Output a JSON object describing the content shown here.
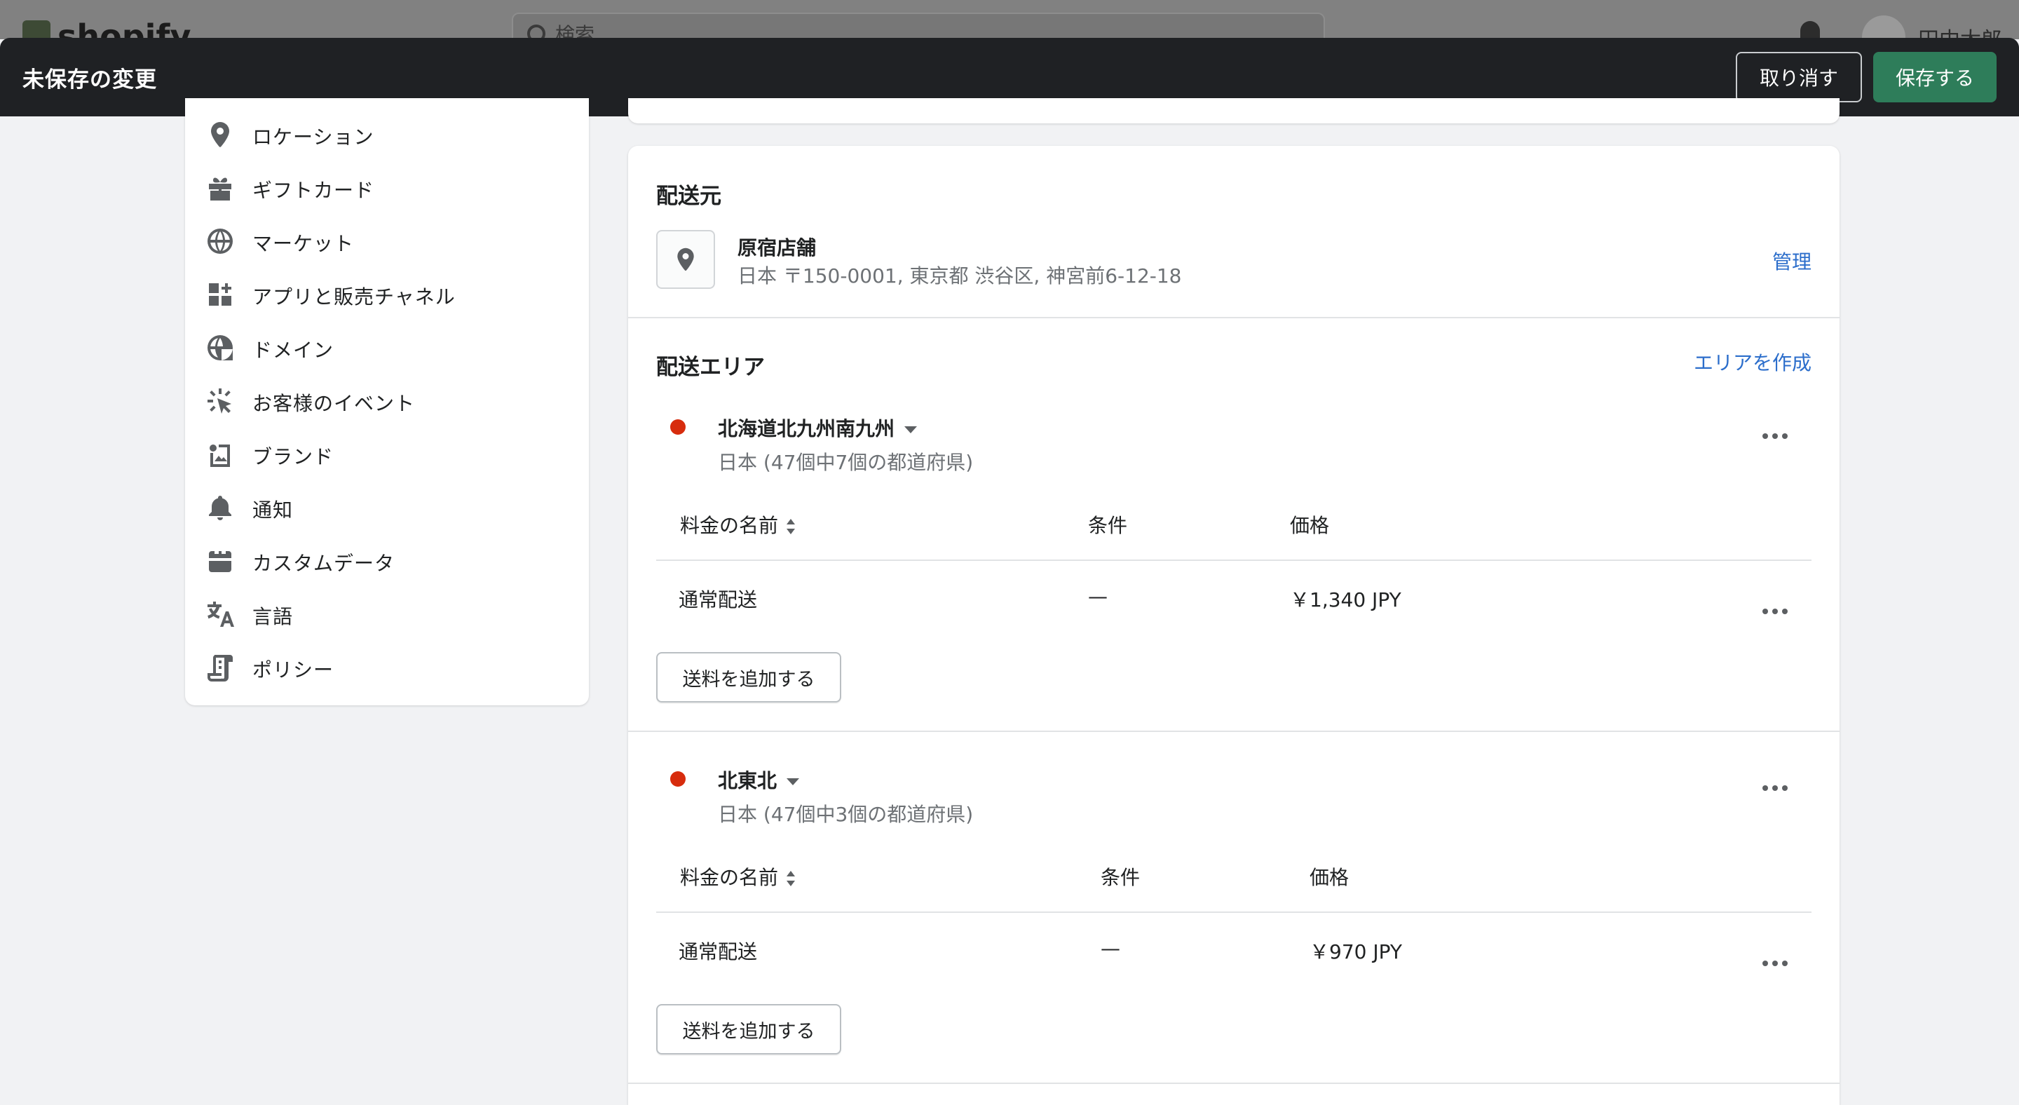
{
  "topbar": {
    "logo_text": "shopify",
    "search_placeholder": "検索",
    "user_name": "田中太郎"
  },
  "savebar": {
    "title": "未保存の変更",
    "discard_label": "取り消す",
    "save_label": "保存する",
    "save_color": "#2e7d5a",
    "bar_color": "#1f2124"
  },
  "sidebar": {
    "items": [
      {
        "label": "ロケーション",
        "icon": "location-pin-icon"
      },
      {
        "label": "ギフトカード",
        "icon": "gift-icon"
      },
      {
        "label": "マーケット",
        "icon": "globe-icon"
      },
      {
        "label": "アプリと販売チャネル",
        "icon": "apps-icon"
      },
      {
        "label": "ドメイン",
        "icon": "domain-globe-icon"
      },
      {
        "label": "お客様のイベント",
        "icon": "cursor-click-icon"
      },
      {
        "label": "ブランド",
        "icon": "brand-image-icon"
      },
      {
        "label": "通知",
        "icon": "bell-icon"
      },
      {
        "label": "カスタムデータ",
        "icon": "custom-data-icon"
      },
      {
        "label": "言語",
        "icon": "language-icon"
      },
      {
        "label": "ポリシー",
        "icon": "policy-document-icon"
      }
    ]
  },
  "shipping_origin": {
    "heading": "配送元",
    "location_name": "原宿店舗",
    "address": "日本 〒150-0001, 東京都 渋谷区, 神宮前6-12-18",
    "manage_label": "管理"
  },
  "shipping_zones": {
    "heading": "配送エリア",
    "create_label": "エリアを作成",
    "column_headers": {
      "rate_name": "料金の名前",
      "condition": "条件",
      "price": "価格"
    },
    "add_rate_label": "送料を追加する",
    "zones": [
      {
        "name": "北海道北九州南九州",
        "subtitle": "日本 (47個中7個の都道府県)",
        "rates": [
          {
            "name": "通常配送",
            "condition": "—",
            "price": "￥1,340 JPY"
          }
        ]
      },
      {
        "name": "北東北",
        "subtitle": "日本 (47個中3個の都道府県)",
        "rates": [
          {
            "name": "通常配送",
            "condition": "—",
            "price": "￥970 JPY"
          }
        ]
      }
    ]
  }
}
